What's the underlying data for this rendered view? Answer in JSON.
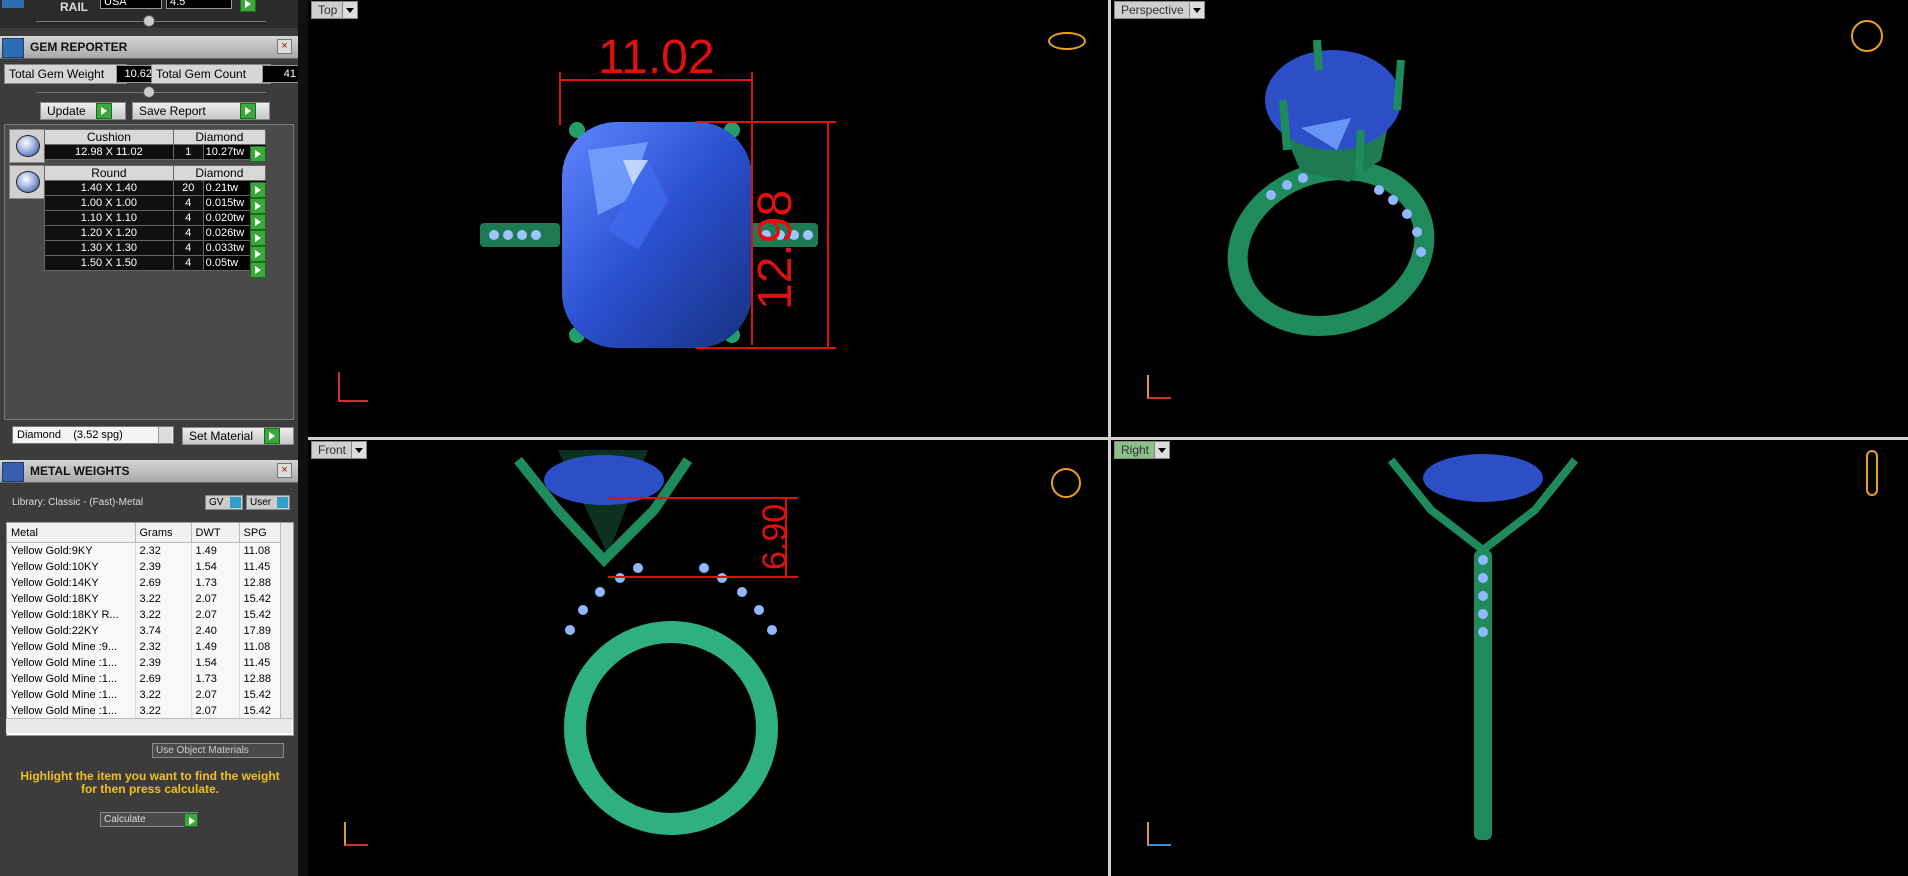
{
  "rail": {
    "title": "RAIL",
    "country": "USA",
    "size": "4.5"
  },
  "gem_reporter": {
    "title": "GEM REPORTER",
    "total_weight_label": "Total Gem Weight",
    "total_weight_value": "10.62",
    "total_count_label": "Total Gem Count",
    "total_count_value": "41",
    "update_label": "Update",
    "save_label": "Save Report",
    "groups": [
      {
        "shape": "Cushion",
        "material": "Diamond",
        "rows": [
          {
            "size": "12.98 X 11.02",
            "count": "1",
            "weight": "10.27tw"
          }
        ]
      },
      {
        "shape": "Round",
        "material": "Diamond",
        "rows": [
          {
            "size": "1.40 X 1.40",
            "count": "20",
            "weight": "0.21tw"
          },
          {
            "size": "1.00 X 1.00",
            "count": "4",
            "weight": "0.015tw"
          },
          {
            "size": "1.10 X 1.10",
            "count": "4",
            "weight": "0.020tw"
          },
          {
            "size": "1.20 X 1.20",
            "count": "4",
            "weight": "0.026tw"
          },
          {
            "size": "1.30 X 1.30",
            "count": "4",
            "weight": "0.033tw"
          },
          {
            "size": "1.50 X 1.50",
            "count": "4",
            "weight": "0.05tw"
          }
        ]
      }
    ],
    "material_select": "Diamond    (3.52 spg)",
    "set_material_label": "Set Material"
  },
  "metal_weights": {
    "title": "METAL WEIGHTS",
    "library": "Library: Classic - (Fast)-Metal",
    "gv_label": "GV",
    "user_label": "User",
    "columns": [
      "Metal",
      "Grams",
      "DWT",
      "SPG"
    ],
    "rows": [
      [
        "Yellow Gold:9KY",
        "2.32",
        "1.49",
        "11.08"
      ],
      [
        "Yellow Gold:10KY",
        "2.39",
        "1.54",
        "11.45"
      ],
      [
        "Yellow Gold:14KY",
        "2.69",
        "1.73",
        "12.88"
      ],
      [
        "Yellow Gold:18KY",
        "3.22",
        "2.07",
        "15.42"
      ],
      [
        "Yellow Gold:18KY R...",
        "3.22",
        "2.07",
        "15.42"
      ],
      [
        "Yellow Gold:22KY",
        "3.74",
        "2.40",
        "17.89"
      ],
      [
        "Yellow Gold Mine :9...",
        "2.32",
        "1.49",
        "11.08"
      ],
      [
        "Yellow Gold Mine :1...",
        "2.39",
        "1.54",
        "11.45"
      ],
      [
        "Yellow Gold Mine :1...",
        "2.69",
        "1.73",
        "12.88"
      ],
      [
        "Yellow Gold Mine :1...",
        "3.22",
        "2.07",
        "15.42"
      ],
      [
        "Yellow Gold Mine :1...",
        "3.22",
        "2.07",
        "15.42"
      ]
    ],
    "use_object_materials": "Use Object Materials",
    "hint": "Highlight the item you want to find the weight for then press calculate.",
    "calculate_label": "Calculate"
  },
  "viewports": {
    "top": {
      "label": "Top",
      "dim_width": "11.02",
      "dim_height": "12.98"
    },
    "perspective": {
      "label": "Perspective"
    },
    "front": {
      "label": "Front",
      "dim_height": "6.90"
    },
    "right": {
      "label": "Right"
    }
  },
  "colors": {
    "metal": "#1f8a5c",
    "metal_light": "#3fbf86",
    "gem": "#2c4fc8",
    "dimension": "#e01010",
    "accent_active": "#8bc08b"
  }
}
